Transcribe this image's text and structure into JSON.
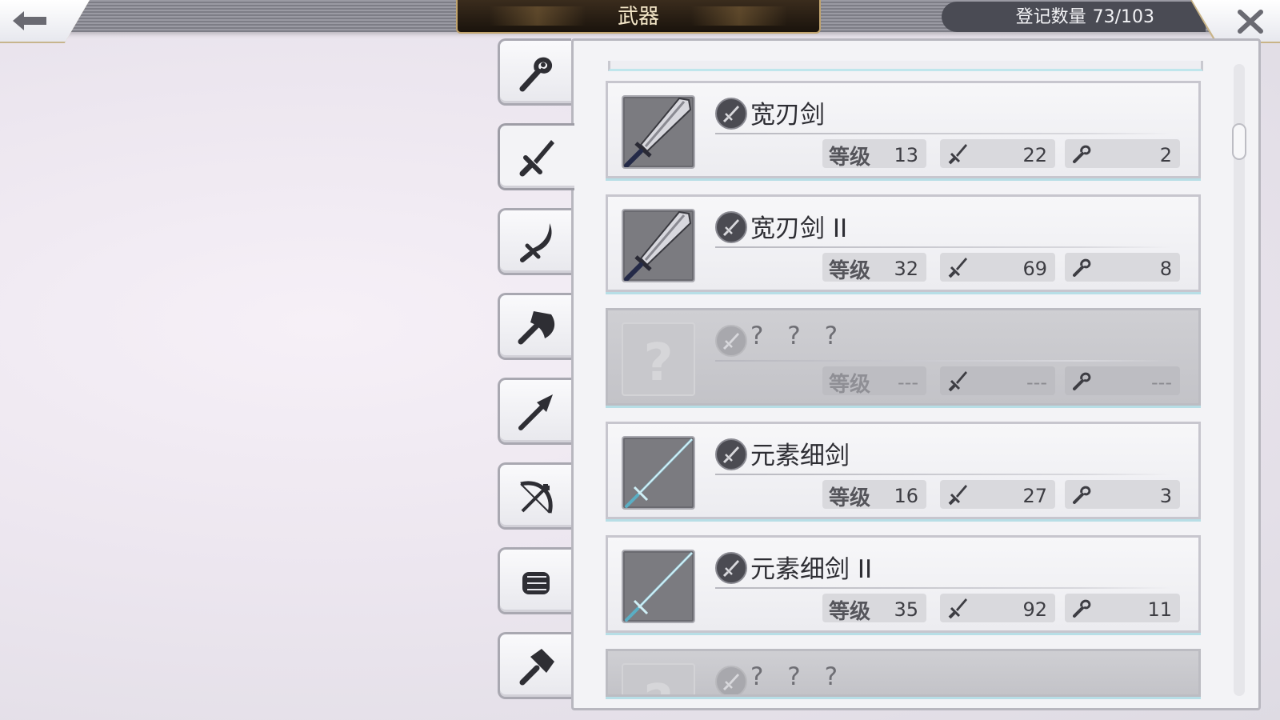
{
  "header": {
    "title": "武器",
    "registered_label": "登记数量",
    "registered_value": "73/103"
  },
  "icons": {
    "back": "back-arrow-icon",
    "close": "close-icon"
  },
  "tabs": [
    {
      "name": "staff",
      "icon": "staff-icon",
      "active": false
    },
    {
      "name": "sword",
      "icon": "sword-icon",
      "active": true
    },
    {
      "name": "scimitar",
      "icon": "scimitar-icon",
      "active": false
    },
    {
      "name": "axe",
      "icon": "axe-icon",
      "active": false
    },
    {
      "name": "spear",
      "icon": "spear-icon",
      "active": false
    },
    {
      "name": "bow",
      "icon": "bow-icon",
      "active": false
    },
    {
      "name": "fist",
      "icon": "gauntlet-icon",
      "active": false
    },
    {
      "name": "hammer",
      "icon": "hammer-icon",
      "active": false
    }
  ],
  "weapons": [
    {
      "name": "宽刃剑",
      "level_label": "等级",
      "level": "13",
      "attack": "22",
      "magic": "2",
      "locked": false,
      "thumb": "greatsword"
    },
    {
      "name": "宽刃剑 II",
      "level_label": "等级",
      "level": "32",
      "attack": "69",
      "magic": "8",
      "locked": false,
      "thumb": "greatsword"
    },
    {
      "name": "? ? ?",
      "level_label": "等级",
      "level": "---",
      "attack": "---",
      "magic": "---",
      "locked": true,
      "thumb": "unknown"
    },
    {
      "name": "元素细剑",
      "level_label": "等级",
      "level": "16",
      "attack": "27",
      "magic": "3",
      "locked": false,
      "thumb": "rapier"
    },
    {
      "name": "元素细剑 II",
      "level_label": "等级",
      "level": "35",
      "attack": "92",
      "magic": "11",
      "locked": false,
      "thumb": "rapier"
    },
    {
      "name": "? ? ?",
      "level_label": "等级",
      "level": "---",
      "attack": "---",
      "magic": "---",
      "locked": true,
      "thumb": "unknown"
    }
  ],
  "colors": {
    "accent_gold": "#c9b487",
    "title_bg": "#1a130c",
    "card_highlight": "#b7dee6"
  }
}
